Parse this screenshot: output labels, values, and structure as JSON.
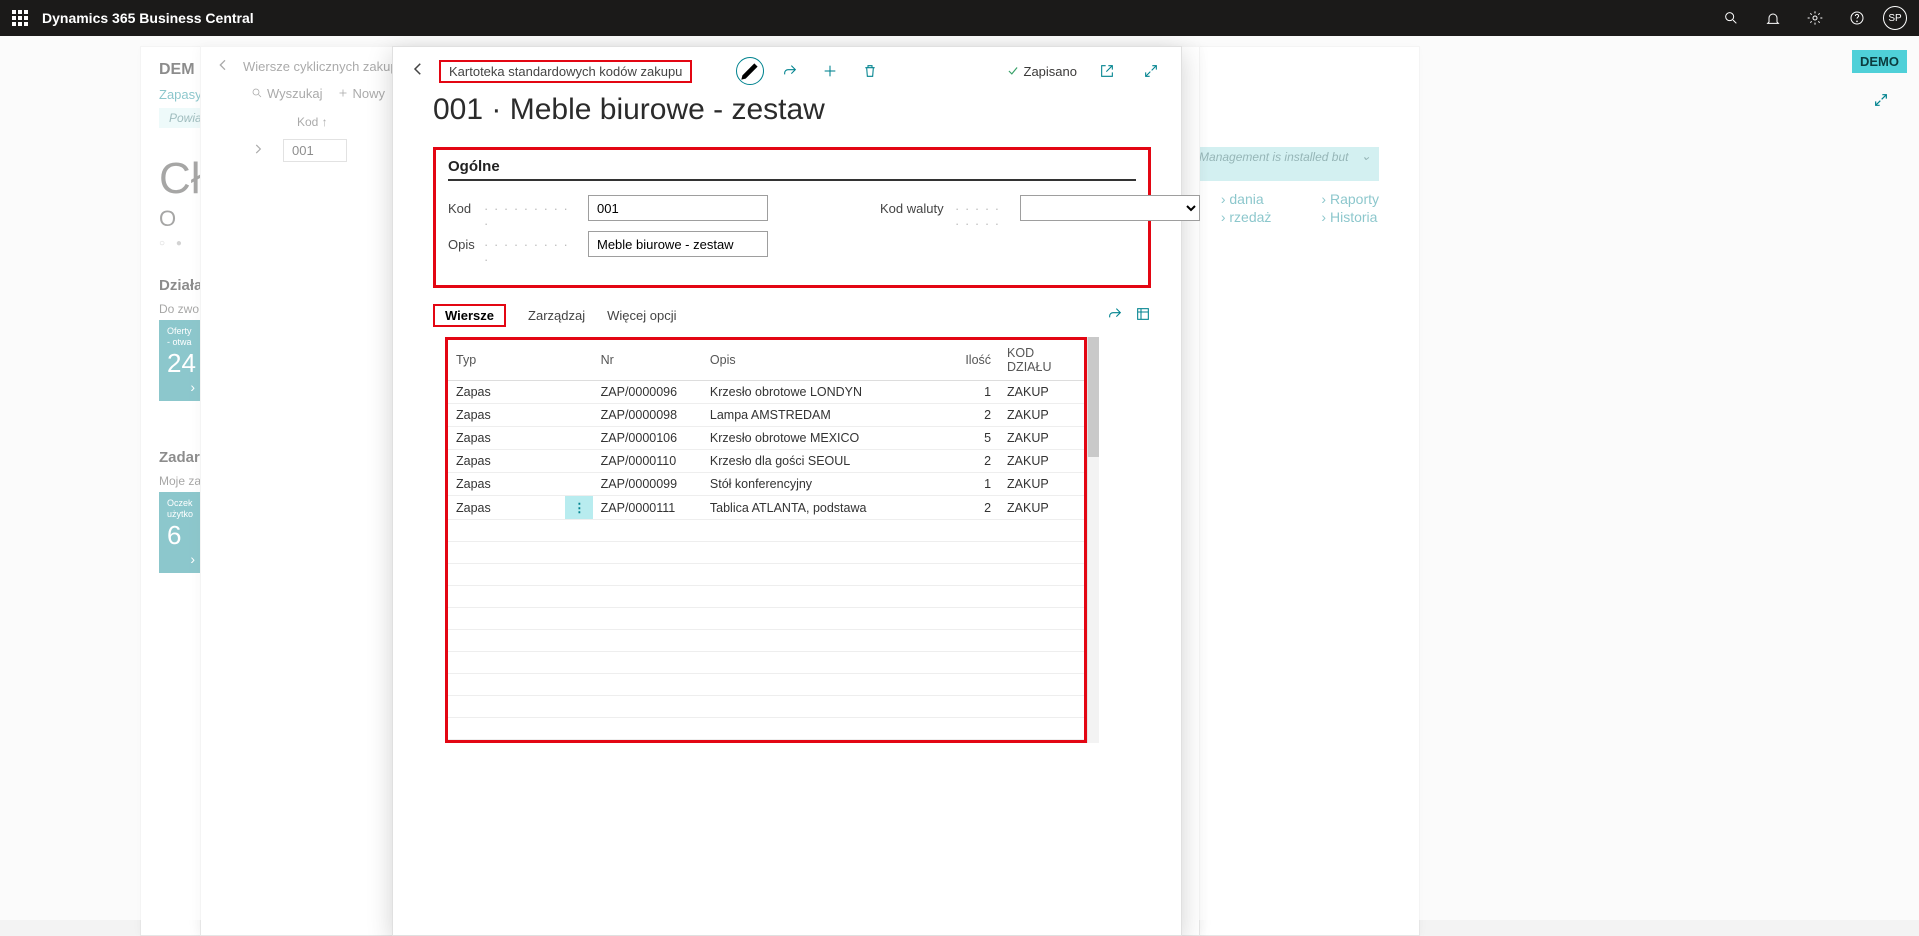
{
  "topbar": {
    "app_title": "Dynamics 365 Business Central",
    "avatar_initials": "SP"
  },
  "demo_badge": "DEMO",
  "rolecenter": {
    "company": "DEM",
    "nav_item": "Zapasy",
    "notice": "Powia",
    "title": "Cł",
    "subtitle": "O",
    "section_activities": "Działa",
    "activities_sub": "Do zwo",
    "tile_label_1": "Oferty",
    "tile_label_2": "- otwa",
    "tile_value": "24",
    "tile_arrow": "›",
    "section_tasks": "Zadar",
    "tasks_sub": "Moje za",
    "tile2_label_1": "Oczek",
    "tile2_label_2": "użytko",
    "tile2_value": "6",
    "right_links": {
      "c1a": "dania",
      "c1b": "rzedaż",
      "c2a": "Raporty",
      "c2b": "Historia"
    },
    "right_notice": "Expense Management is installed but ..."
  },
  "list_panel": {
    "title": "Wiersze cyklicznych zakupó",
    "search": "Wyszukaj",
    "new": "Nowy",
    "col_code": "Kod ↑",
    "row_code": "001"
  },
  "card": {
    "breadcrumb": "Kartoteka standardowych kodów zakupu",
    "saved": "Zapisano",
    "page_title": "001 · Meble biurowe - zestaw",
    "general_header": "Ogólne",
    "labels": {
      "kod": "Kod",
      "opis": "Opis",
      "kod_waluty": "Kod waluty"
    },
    "values": {
      "kod": "001",
      "opis": "Meble biurowe - zestaw",
      "kod_waluty": ""
    },
    "lines": {
      "tab": "Wiersze",
      "manage": "Zarządzaj",
      "more": "Więcej opcji",
      "headers": {
        "typ": "Typ",
        "nr": "Nr",
        "opis": "Opis",
        "ilosc": "Ilość",
        "kod_dzialu": "KOD DZIAŁU"
      },
      "rows": [
        {
          "typ": "Zapas",
          "nr": "ZAP/0000096",
          "opis": "Krzesło obrotowe LONDYN",
          "ilosc": 1,
          "dzial": "ZAKUP"
        },
        {
          "typ": "Zapas",
          "nr": "ZAP/0000098",
          "opis": "Lampa AMSTREDAM",
          "ilosc": 2,
          "dzial": "ZAKUP"
        },
        {
          "typ": "Zapas",
          "nr": "ZAP/0000106",
          "opis": "Krzesło obrotowe MEXICO",
          "ilosc": 5,
          "dzial": "ZAKUP"
        },
        {
          "typ": "Zapas",
          "nr": "ZAP/0000110",
          "opis": "Krzesło dla gości SEOUL",
          "ilosc": 2,
          "dzial": "ZAKUP"
        },
        {
          "typ": "Zapas",
          "nr": "ZAP/0000099",
          "opis": "Stół konferencyjny",
          "ilosc": 1,
          "dzial": "ZAKUP"
        },
        {
          "typ": "Zapas",
          "nr": "ZAP/0000111",
          "opis": "Tablica ATLANTA, podstawa",
          "ilosc": 2,
          "dzial": "ZAKUP"
        }
      ]
    }
  }
}
